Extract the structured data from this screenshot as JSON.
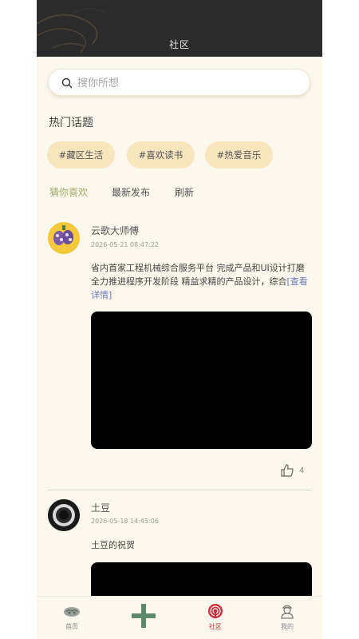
{
  "header": {
    "title": "社区"
  },
  "search": {
    "placeholder": "搜你所想"
  },
  "hot_topics": {
    "title": "热门话题",
    "items": [
      {
        "label": "#藏区生活"
      },
      {
        "label": "#喜欢读书"
      },
      {
        "label": "#热爱音乐"
      }
    ]
  },
  "feed_tabs": [
    {
      "label": "猜你喜欢",
      "active": true
    },
    {
      "label": "最新发布",
      "active": false
    },
    {
      "label": "刷新",
      "active": false
    }
  ],
  "posts": [
    {
      "author": "云歌大师傅",
      "time": "2026-05-21 08:47:22",
      "content": "省内首家工程机械综合服务平台 完成产品和UI设计打磨 全力推进程序开发阶段 精益求精的产品设计，综合",
      "more": "[查看详情]",
      "likes": "4"
    },
    {
      "author": "土豆",
      "time": "2026-05-18 14:45:06",
      "content": "土豆的祝贺"
    }
  ],
  "tabbar": {
    "items": [
      {
        "label": "首页",
        "icon": "home-cloud-icon"
      },
      {
        "label": "",
        "icon": "plus-icon"
      },
      {
        "label": "社区",
        "icon": "community-icon",
        "active": true
      },
      {
        "label": "我的",
        "icon": "profile-icon"
      }
    ]
  },
  "colors": {
    "background": "#fdf8ee",
    "header": "#2b2b2b",
    "topic_chip": "#f8e6bf",
    "active_tab": "#a3a86a",
    "accent_red": "#c8323a",
    "plus_green": "#5a8a6a"
  }
}
